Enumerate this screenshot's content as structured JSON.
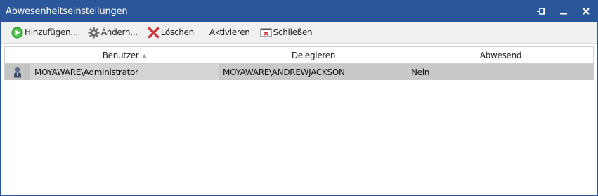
{
  "window": {
    "title": "Abwesenheitseinstellungen",
    "controls": {
      "pin_icon": "pin-icon",
      "minimize_icon": "minimize-icon",
      "close_icon": "close-icon"
    }
  },
  "toolbar": {
    "add_label": "Hinzufügen...",
    "edit_label": "Ändern...",
    "delete_label": "Löschen",
    "activate_label": "Aktivieren",
    "close_label": "Schließen"
  },
  "grid": {
    "columns": {
      "user": "Benutzer",
      "delegate": "Delegieren",
      "absent": "Abwesend"
    },
    "sorted_column": "Benutzer",
    "sort_direction": "ascending",
    "rows": [
      {
        "user": "MOYAWARE\\Administrator",
        "delegate": "MOYAWARE\\ANDREWJACKSON",
        "absent": "Nein",
        "icon": "user-icon",
        "selected": true
      }
    ]
  },
  "colors": {
    "titlebar": "#2b579a",
    "toolbar_bg": "#f0f0f0",
    "selected_row": "#c9c9c9",
    "add_icon": "#2ea12e",
    "delete_icon": "#d13438"
  }
}
